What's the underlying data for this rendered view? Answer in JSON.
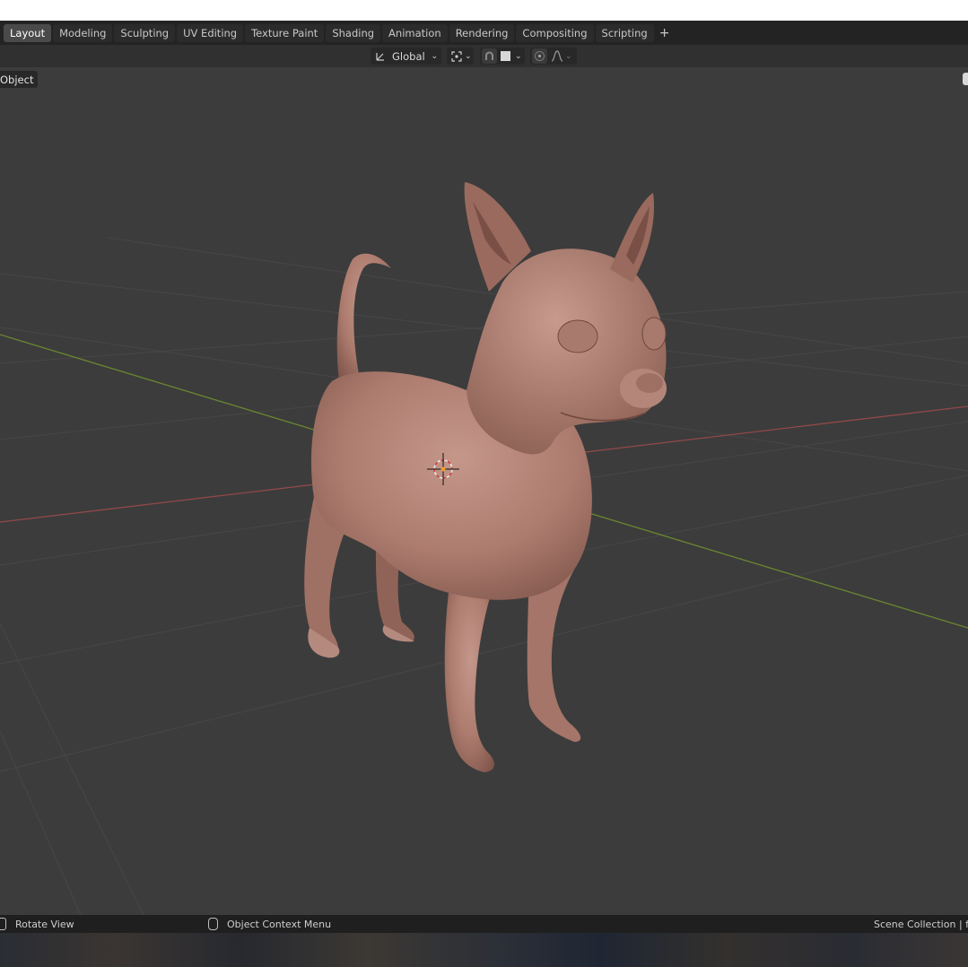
{
  "workspace_tabs": [
    "Layout",
    "Modeling",
    "Sculpting",
    "UV Editing",
    "Texture Paint",
    "Shading",
    "Animation",
    "Rendering",
    "Compositing",
    "Scripting"
  ],
  "active_tab": "Layout",
  "add_tab_label": "+",
  "header": {
    "orientation_label": "Global"
  },
  "viewport": {
    "mode_label": "Object"
  },
  "status": {
    "rotate_view": "Rotate View",
    "context_menu": "Object Context Menu",
    "collection": "Scene Collection | fe"
  },
  "colors": {
    "viewport_bg": "#3c3c3c",
    "x_axis": "#9a4a4c",
    "y_axis": "#6e8a32",
    "model_skin": "#b07e72"
  }
}
